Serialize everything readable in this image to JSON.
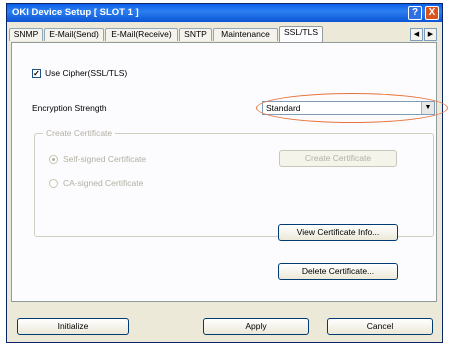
{
  "window": {
    "title": "OKI Device Setup [ SLOT 1 ]",
    "help_glyph": "?",
    "close_glyph": "X"
  },
  "tabs": [
    "SNMP",
    "E-Mail(Send)",
    "E-Mail(Receive)",
    "SNTP",
    "Maintenance",
    "SSL/TLS"
  ],
  "active_tab": "SSL/TLS",
  "tab_scroll": {
    "left": "◀",
    "right": "▶"
  },
  "panel": {
    "use_cipher": {
      "label": "Use Cipher(SSL/TLS)",
      "checked": true,
      "mark": "✓"
    },
    "encryption_strength": {
      "label": "Encryption Strength",
      "value": "Standard",
      "arrow": "▼"
    },
    "create_certificate_group": {
      "title": "Create Certificate",
      "self_signed": "Self-signed Certificate",
      "ca_signed": "CA-signed Certificate",
      "create_button": "Create Certificate"
    },
    "view_info_button": "View Certificate Info...",
    "delete_button": "Delete Certificate..."
  },
  "footer": {
    "initialize": "Initialize",
    "apply": "Apply",
    "cancel": "Cancel"
  },
  "colors": {
    "title_bar": "#0a5ee8",
    "highlight": "#e8743b",
    "disabled_text": "#b3b0a3"
  }
}
